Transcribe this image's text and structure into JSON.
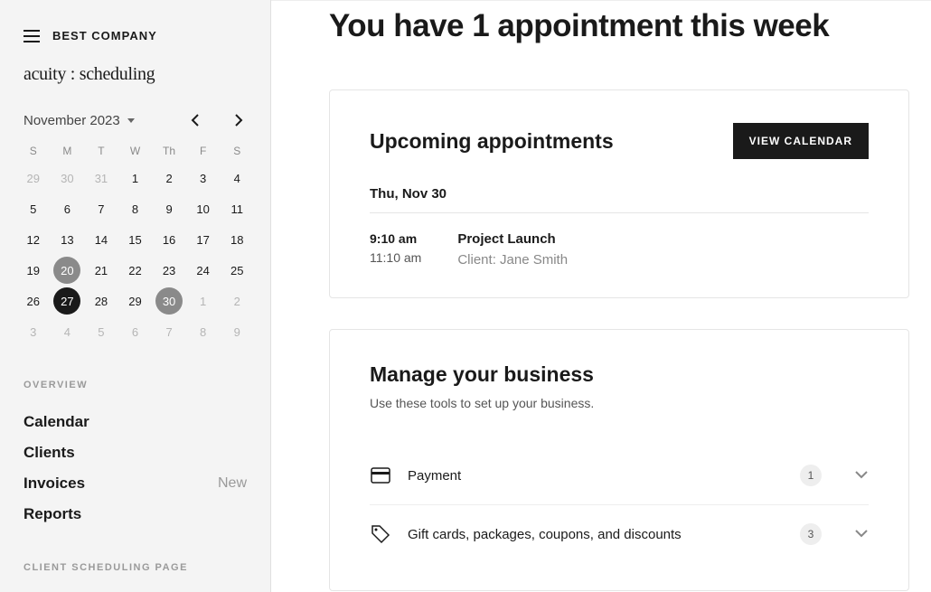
{
  "header": {
    "company": "BEST COMPANY",
    "product": "acuity : scheduling"
  },
  "calendar": {
    "month_label": "November 2023",
    "dow": [
      "S",
      "M",
      "T",
      "W",
      "Th",
      "F",
      "S"
    ],
    "weeks": [
      [
        {
          "d": "29",
          "m": true
        },
        {
          "d": "30",
          "m": true
        },
        {
          "d": "31",
          "m": true
        },
        {
          "d": "1"
        },
        {
          "d": "2"
        },
        {
          "d": "3"
        },
        {
          "d": "4"
        }
      ],
      [
        {
          "d": "5"
        },
        {
          "d": "6"
        },
        {
          "d": "7"
        },
        {
          "d": "8"
        },
        {
          "d": "9"
        },
        {
          "d": "10"
        },
        {
          "d": "11"
        }
      ],
      [
        {
          "d": "12"
        },
        {
          "d": "13"
        },
        {
          "d": "14"
        },
        {
          "d": "15"
        },
        {
          "d": "16"
        },
        {
          "d": "17"
        },
        {
          "d": "18"
        }
      ],
      [
        {
          "d": "19"
        },
        {
          "d": "20",
          "today": true
        },
        {
          "d": "21"
        },
        {
          "d": "22"
        },
        {
          "d": "23"
        },
        {
          "d": "24"
        },
        {
          "d": "25"
        }
      ],
      [
        {
          "d": "26"
        },
        {
          "d": "27",
          "selected": true
        },
        {
          "d": "28"
        },
        {
          "d": "29"
        },
        {
          "d": "30",
          "event": true
        },
        {
          "d": "1",
          "m": true
        },
        {
          "d": "2",
          "m": true
        }
      ],
      [
        {
          "d": "3",
          "m": true
        },
        {
          "d": "4",
          "m": true
        },
        {
          "d": "5",
          "m": true
        },
        {
          "d": "6",
          "m": true
        },
        {
          "d": "7",
          "m": true
        },
        {
          "d": "8",
          "m": true
        },
        {
          "d": "9",
          "m": true
        }
      ]
    ]
  },
  "nav": {
    "overview_title": "OVERVIEW",
    "items": [
      {
        "label": "Calendar"
      },
      {
        "label": "Clients"
      },
      {
        "label": "Invoices",
        "badge": "New"
      },
      {
        "label": "Reports"
      }
    ],
    "next_section_title": "CLIENT SCHEDULING PAGE"
  },
  "main": {
    "title": "You have 1 appointment this week",
    "upcoming": {
      "title": "Upcoming appointments",
      "cta": "VIEW CALENDAR",
      "date": "Thu, Nov 30",
      "start": "9:10 am",
      "end": "11:10 am",
      "event": "Project Launch",
      "client": "Client: Jane Smith"
    },
    "manage": {
      "title": "Manage your business",
      "sub": "Use these tools to set up your business.",
      "rows": [
        {
          "icon": "card",
          "label": "Payment",
          "count": "1"
        },
        {
          "icon": "tag",
          "label": "Gift cards, packages, coupons, and discounts",
          "count": "3"
        }
      ]
    }
  }
}
